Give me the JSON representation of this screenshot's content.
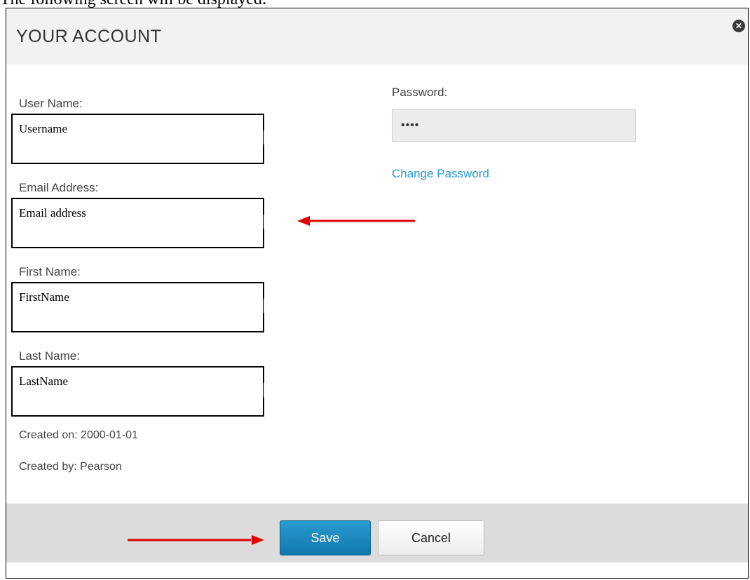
{
  "caption": "The following screen will be displayed:",
  "dialog": {
    "title": "YOUR ACCOUNT",
    "close_icon": "close-icon",
    "fields": {
      "username": {
        "label": "User Name:",
        "value": "Username"
      },
      "email": {
        "label": "Email Address:",
        "value": "Email address"
      },
      "first_name": {
        "label": "First Name:",
        "value": "FirstName"
      },
      "last_name": {
        "label": "Last Name:",
        "value": "LastName"
      }
    },
    "password": {
      "label": "Password:",
      "value": "••••"
    },
    "change_password_link": "Change Password",
    "created_on": "Created on: 2000-01-01",
    "created_by": "Created by: Pearson",
    "buttons": {
      "save": "Save",
      "cancel": "Cancel"
    }
  },
  "annotations": {
    "arrow_color": "#e00000"
  },
  "colors": {
    "header_bg": "#f2f2f2",
    "footer_bg": "#dcdcdc",
    "save_button": "#1d86bf",
    "link": "#2d9ad6"
  }
}
